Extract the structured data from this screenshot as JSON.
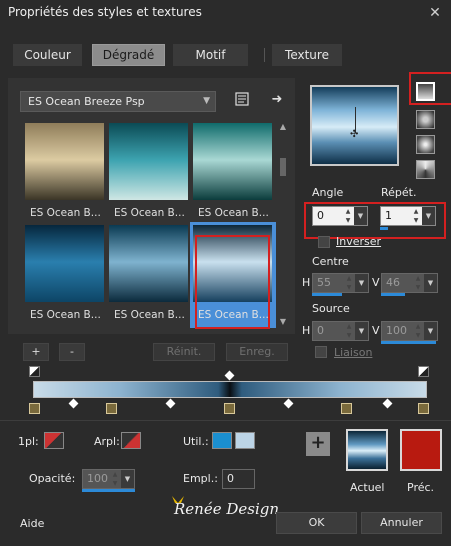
{
  "window": {
    "title": "Propriétés des styles et textures",
    "close_glyph": "✕"
  },
  "tabs": [
    {
      "label": "Couleur",
      "active": false
    },
    {
      "label": "Dégradé",
      "active": true
    },
    {
      "label": "Motif",
      "active": false
    },
    {
      "label": "Texture",
      "active": false
    }
  ],
  "preset": {
    "selected": "ES Ocean Breeze Psp"
  },
  "swatches": [
    {
      "label": "ES Ocean B...",
      "colors": [
        "#8f7d5a",
        "#dccba2",
        "#3b3526"
      ]
    },
    {
      "label": "ES Ocean B...",
      "colors": [
        "#0b4b55",
        "#3da3b0",
        "#cfe7e4"
      ]
    },
    {
      "label": "ES Ocean B...",
      "colors": [
        "#0f6b6b",
        "#a9d8d4",
        "#0b3c3c"
      ]
    },
    {
      "label": "ES Ocean B...",
      "colors": [
        "#06273d",
        "#2a7fae",
        "#0d4566"
      ]
    },
    {
      "label": "ES Ocean B...",
      "colors": [
        "#0a3a52",
        "#7fb3cf",
        "#0b2a3c"
      ]
    },
    {
      "label": "ES Ocean B...",
      "colors": [
        "#0c2638",
        "#c9e0ee",
        "#16405e"
      ],
      "selected": true
    }
  ],
  "grid_buttons": {
    "add": "+",
    "remove": "-",
    "reset": "Réinit.",
    "save": "Enreg."
  },
  "angle": {
    "label": "Angle",
    "value": "0"
  },
  "repeat": {
    "label": "Répét.",
    "value": "1"
  },
  "invert": {
    "label": "Inverser"
  },
  "centre": {
    "label": "Centre",
    "h_label": "H",
    "h_value": "55",
    "v_label": "V",
    "v_value": "46"
  },
  "source": {
    "label": "Source",
    "h_label": "H",
    "h_value": "0",
    "v_label": "V",
    "v_value": "100"
  },
  "link": {
    "label": "Liaison"
  },
  "gradient_styles": [
    "linear-style-icon",
    "rectangular-style-icon",
    "radial-style-icon",
    "sunburst-style-icon"
  ],
  "stops": {
    "pl_label": "1pl:",
    "arpl_label": "Arpl:",
    "util_label": "Util.:",
    "opacity_label": "Opacité:",
    "opacity_value": "100",
    "empl_label": "Empl.:",
    "empl_value": "0",
    "util_colors": [
      "#1b8fd0",
      "#bcd4e6"
    ]
  },
  "preview_labels": {
    "current": "Actuel",
    "previous": "Préc."
  },
  "previous_color": "#b81a10",
  "watermark": "Renée Design",
  "footer": {
    "help": "Aide",
    "ok": "OK",
    "cancel": "Annuler"
  }
}
